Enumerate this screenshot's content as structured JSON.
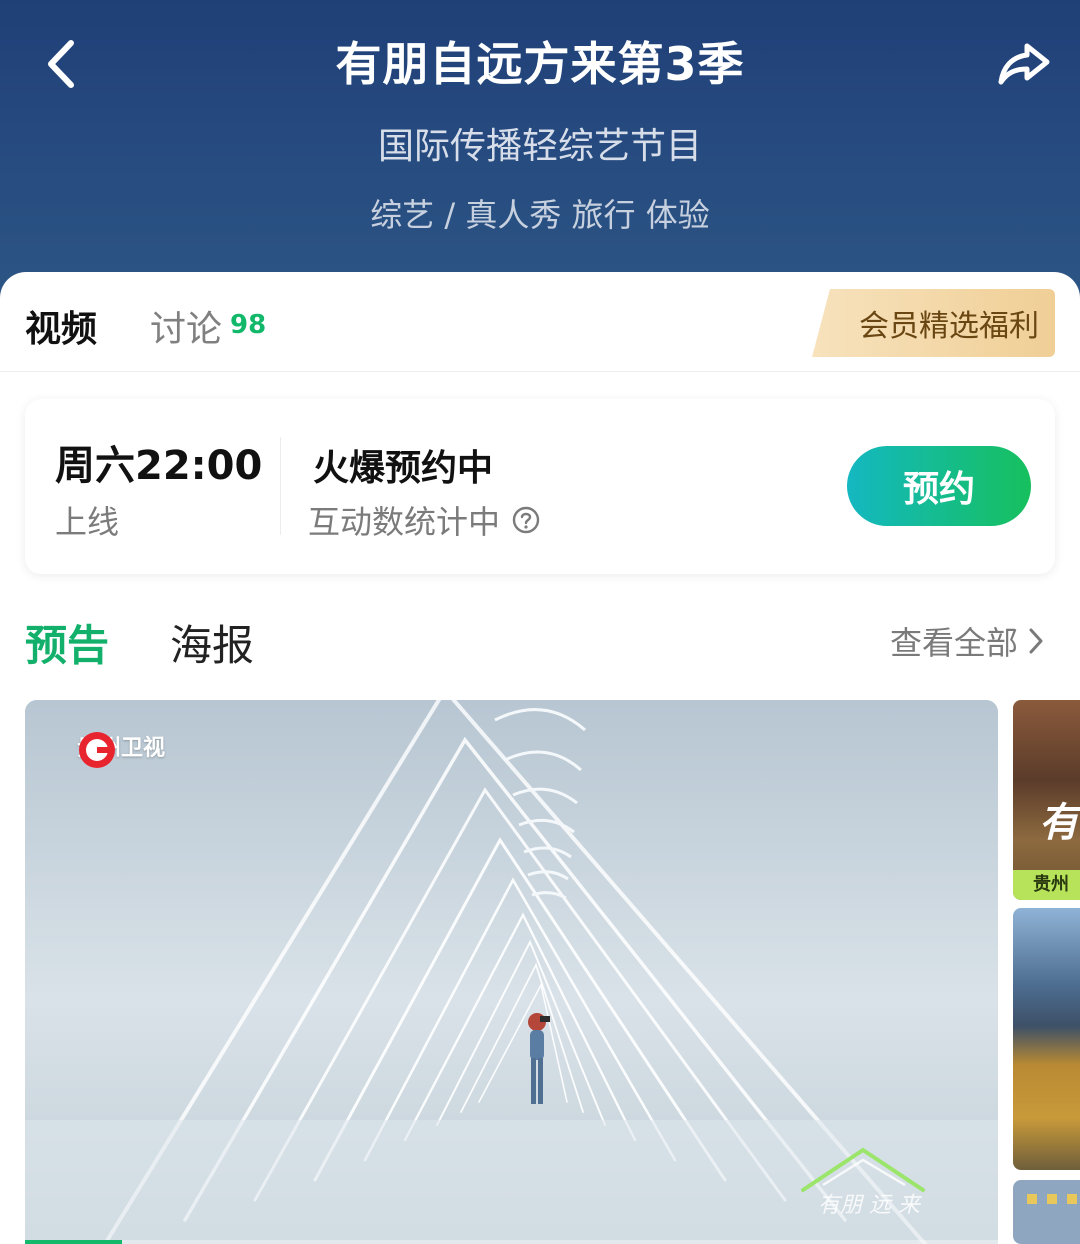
{
  "header": {
    "title": "有朋自远方来第3季",
    "subtitle": "国际传播轻综艺节目",
    "genres": "综艺 / 真人秀 旅行 体验"
  },
  "tabs": {
    "video": "视频",
    "discuss": "讨论",
    "discuss_count": "98",
    "member_badge": "会员精选福利"
  },
  "reservation": {
    "time": "周六22:00",
    "online_label": "上线",
    "hot_label": "火爆预约中",
    "stat_label": "互动数统计中",
    "button": "预约"
  },
  "section": {
    "trailer_tab": "预告",
    "poster_tab": "海报",
    "view_all": "查看全部"
  },
  "thumbnail": {
    "channel_logo_text": "贵州卫视",
    "watermark": "有朋自远方来",
    "progress_percent": 10
  },
  "side_thumbnail": {
    "channel_text": "贵州卫",
    "title_glyph": "有"
  },
  "colors": {
    "accent_green": "#12b86a",
    "header_blue": "#264a7f",
    "member_gold": "#f0cf96"
  }
}
